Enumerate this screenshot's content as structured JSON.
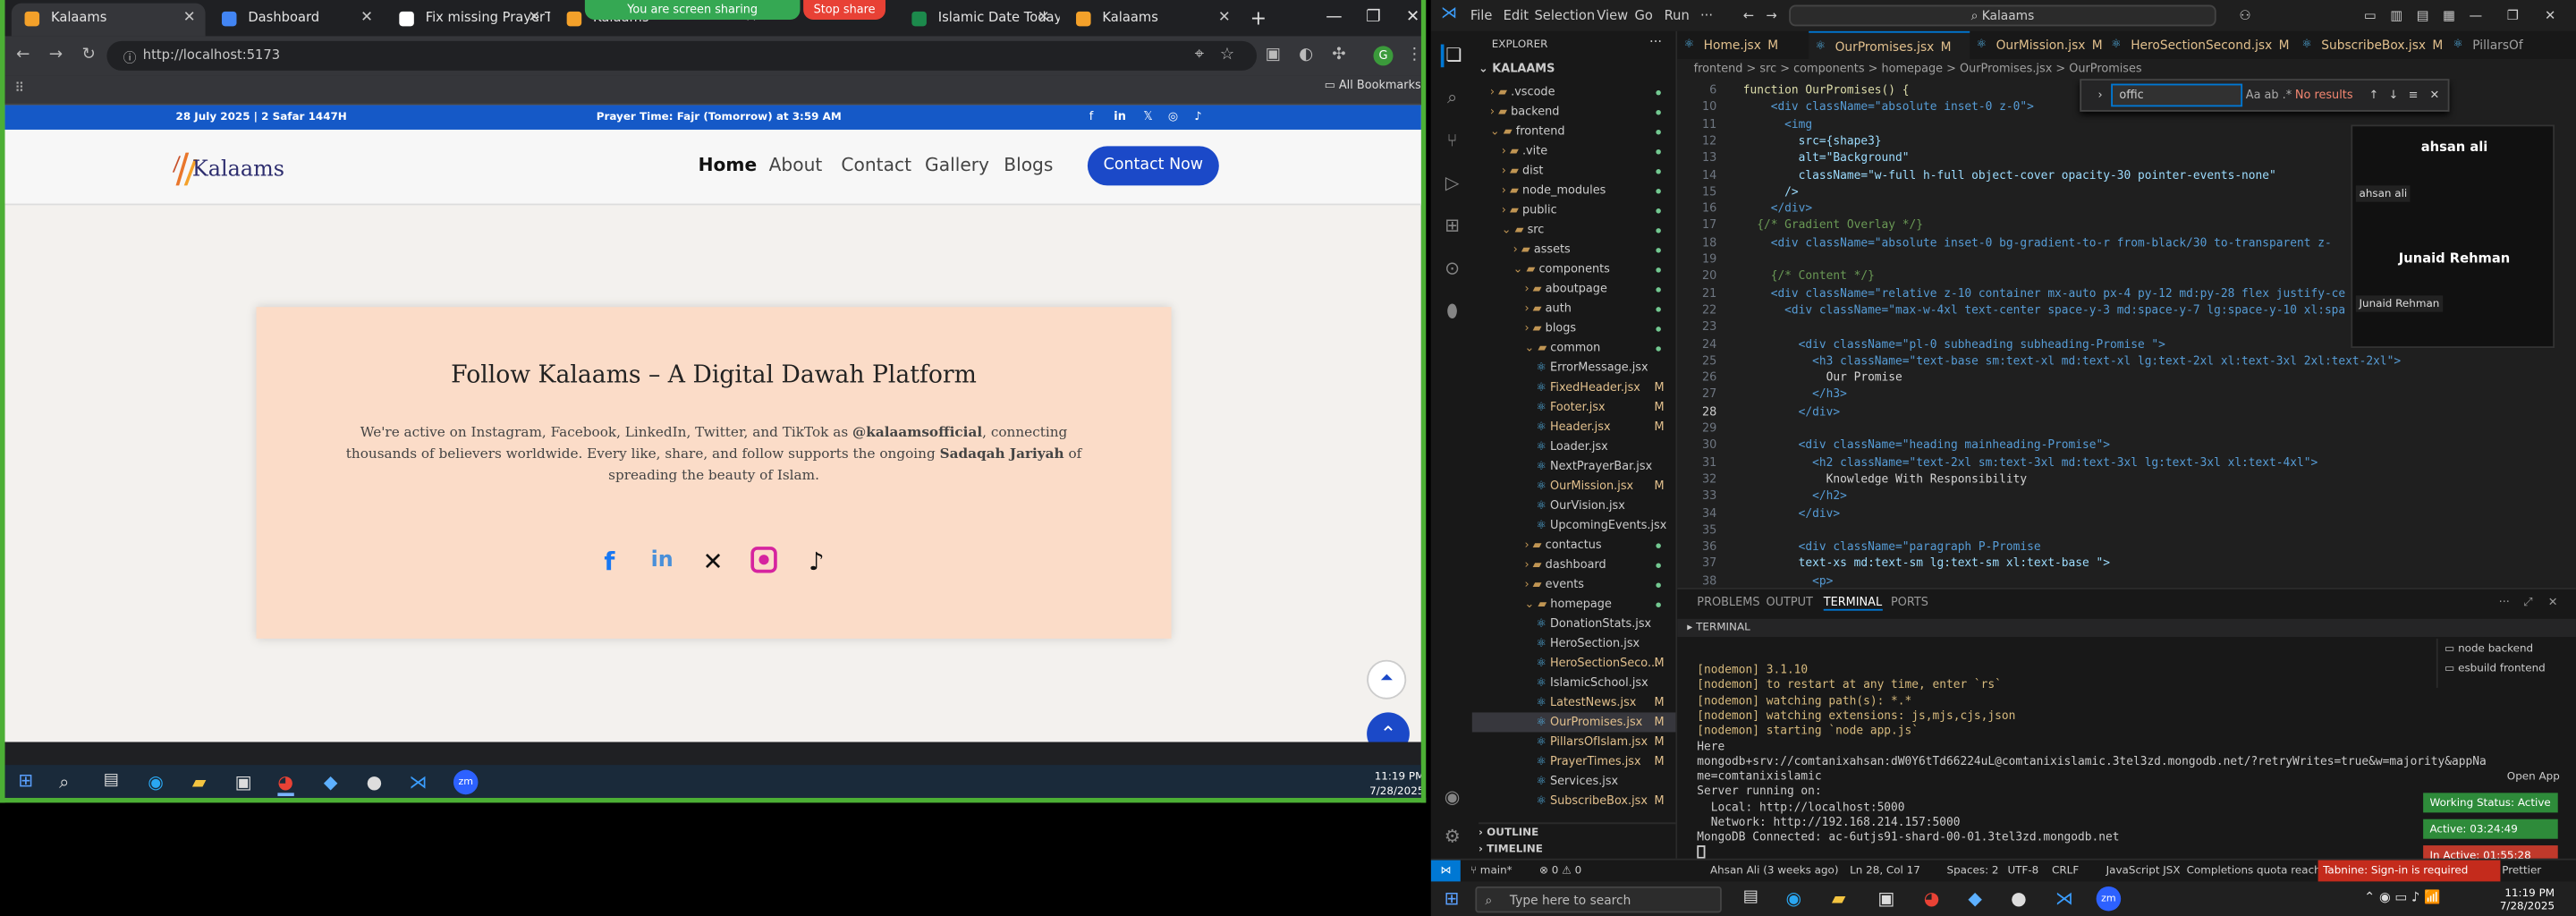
{
  "chrome": {
    "tabs": [
      {
        "label": "Kalaams",
        "color": "#f4a12a",
        "active": true
      },
      {
        "label": "Dashboard",
        "color": "#4285f4",
        "active": false
      },
      {
        "label": "Fix missing PrayerTime",
        "color": "#ffffff",
        "active": false
      },
      {
        "label": "Kalaams",
        "color": "#f4a12a",
        "active": false
      },
      {
        "label": "Islamic Date Today - H",
        "color": "#1c8a4c",
        "active": false
      },
      {
        "label": "Kalaams",
        "color": "#f4a12a",
        "active": false
      }
    ],
    "share_banner": "You are screen sharing",
    "stop_share": "Stop share",
    "address": "http://localhost:5173",
    "bookmarks_label": "All Bookmarks"
  },
  "site": {
    "top_date": "28 July 2025 | 2 Safar 1447H",
    "prayer_prefix": "Prayer Time: ",
    "prayer_name": "Fajr (Tomorrow)",
    "prayer_suffix": " at 3:59 AM",
    "logo_text": "Kalaams",
    "nav": [
      "Home",
      "About",
      "Contact",
      "Gallery",
      "Blogs"
    ],
    "contact_btn": "Contact Now",
    "card": {
      "title": "Follow Kalaams – A Digital Dawah Platform",
      "text_1": "We're active on Instagram, Facebook, LinkedIn, Twitter, and TikTok as ",
      "handle": "@kalaamsofficial",
      "text_2": ", connecting thousands of believers worldwide. Every like, share, and follow supports the ongoing ",
      "sadaqah": "Sadaqah Jariyah",
      "text_3": " of spreading the beauty of Islam."
    }
  },
  "taskbar_left": {
    "time": "11:19 PM",
    "date": "7/28/2025"
  },
  "vscode": {
    "menu": [
      "File",
      "Edit",
      "Selection",
      "View",
      "Go",
      "Run"
    ],
    "search": "Kalaams",
    "explorer_title": "EXPLORER",
    "workspace": "KALAAMS",
    "tree": [
      {
        "label": ".vscode",
        "indent": 1,
        "kind": "folder-closed"
      },
      {
        "label": "backend",
        "indent": 1,
        "kind": "folder-closed"
      },
      {
        "label": "frontend",
        "indent": 1,
        "kind": "folder-open"
      },
      {
        "label": ".vite",
        "indent": 2,
        "kind": "folder-closed"
      },
      {
        "label": "dist",
        "indent": 2,
        "kind": "folder-closed"
      },
      {
        "label": "node_modules",
        "indent": 2,
        "kind": "folder-closed"
      },
      {
        "label": "public",
        "indent": 2,
        "kind": "folder-closed"
      },
      {
        "label": "src",
        "indent": 2,
        "kind": "folder-open"
      },
      {
        "label": "assets",
        "indent": 3,
        "kind": "folder-closed"
      },
      {
        "label": "components",
        "indent": 3,
        "kind": "folder-open"
      },
      {
        "label": "aboutpage",
        "indent": 4,
        "kind": "folder-closed"
      },
      {
        "label": "auth",
        "indent": 4,
        "kind": "folder-closed"
      },
      {
        "label": "blogs",
        "indent": 4,
        "kind": "folder-closed"
      },
      {
        "label": "common",
        "indent": 4,
        "kind": "folder-open"
      },
      {
        "label": "ErrorMessage.jsx",
        "indent": 5,
        "kind": "file"
      },
      {
        "label": "FixedHeader.jsx",
        "indent": 5,
        "kind": "file",
        "mark": "M"
      },
      {
        "label": "Footer.jsx",
        "indent": 5,
        "kind": "file",
        "mark": "M"
      },
      {
        "label": "Header.jsx",
        "indent": 5,
        "kind": "file",
        "mark": "M"
      },
      {
        "label": "Loader.jsx",
        "indent": 5,
        "kind": "file"
      },
      {
        "label": "NextPrayerBar.jsx",
        "indent": 5,
        "kind": "file"
      },
      {
        "label": "OurMission.jsx",
        "indent": 5,
        "kind": "file",
        "mark": "M"
      },
      {
        "label": "OurVision.jsx",
        "indent": 5,
        "kind": "file"
      },
      {
        "label": "UpcomingEvents.jsx",
        "indent": 5,
        "kind": "file"
      },
      {
        "label": "contactus",
        "indent": 4,
        "kind": "folder-closed"
      },
      {
        "label": "dashboard",
        "indent": 4,
        "kind": "folder-closed"
      },
      {
        "label": "events",
        "indent": 4,
        "kind": "folder-closed"
      },
      {
        "label": "homepage",
        "indent": 4,
        "kind": "folder-open"
      },
      {
        "label": "DonationStats.jsx",
        "indent": 5,
        "kind": "file"
      },
      {
        "label": "HeroSection.jsx",
        "indent": 5,
        "kind": "file"
      },
      {
        "label": "HeroSectionSeco...",
        "indent": 5,
        "kind": "file",
        "mark": "M"
      },
      {
        "label": "IslamicSchool.jsx",
        "indent": 5,
        "kind": "file"
      },
      {
        "label": "LatestNews.jsx",
        "indent": 5,
        "kind": "file",
        "mark": "M"
      },
      {
        "label": "OurPromises.jsx",
        "indent": 5,
        "kind": "file",
        "mark": "M",
        "selected": true
      },
      {
        "label": "PillarsOfIslam.jsx",
        "indent": 5,
        "kind": "file",
        "mark": "M"
      },
      {
        "label": "PrayerTimes.jsx",
        "indent": 5,
        "kind": "file",
        "mark": "M"
      },
      {
        "label": "Services.jsx",
        "indent": 5,
        "kind": "file"
      },
      {
        "label": "SubscribeBox.jsx",
        "indent": 5,
        "kind": "file",
        "mark": "M"
      }
    ],
    "outline": "OUTLINE",
    "timeline": "TIMELINE",
    "editor_tabs": [
      {
        "label": "Home.jsx",
        "mark": "M"
      },
      {
        "label": "OurPromises.jsx",
        "mark": "M",
        "active": true
      },
      {
        "label": "OurMission.jsx",
        "mark": "M"
      },
      {
        "label": "HeroSectionSecond.jsx",
        "mark": "M"
      },
      {
        "label": "SubscribeBox.jsx",
        "mark": "M"
      },
      {
        "label": "PillarsOf",
        "mark": ""
      }
    ],
    "breadcrumb": "frontend > src > components > homepage > OurPromises.jsx > OurPromises",
    "find_value": "offic",
    "find_result": "No results",
    "code": [
      {
        "n": "6",
        "t": "function OurPromises() {"
      },
      {
        "n": "10",
        "t": "    <div className=\"absolute inset-0 z-0\">"
      },
      {
        "n": "11",
        "t": "      <img"
      },
      {
        "n": "12",
        "t": "        src={shape3}"
      },
      {
        "n": "13",
        "t": "        alt=\"Background\""
      },
      {
        "n": "14",
        "t": "        className=\"w-full h-full object-cover opacity-30 pointer-events-none\""
      },
      {
        "n": "15",
        "t": "      />"
      },
      {
        "n": "16",
        "t": "    </div>"
      },
      {
        "n": "17",
        "t": "  {/* Gradient Overlay */}"
      },
      {
        "n": "18",
        "t": "    <div className=\"absolute inset-0 bg-gradient-to-r from-black/30 to-transparent z-"
      },
      {
        "n": "19",
        "t": ""
      },
      {
        "n": "20",
        "t": "    {/* Content */}"
      },
      {
        "n": "21",
        "t": "    <div className=\"relative z-10 container mx-auto px-4 py-12 md:py-28 flex justify-ce"
      },
      {
        "n": "22",
        "t": "      <div className=\"max-w-4xl text-center space-y-3 md:space-y-7 lg:space-y-10 xl:spa"
      },
      {
        "n": "23",
        "t": ""
      },
      {
        "n": "24",
        "t": "        <div className=\"pl-0 subheading subheading-Promise \">"
      },
      {
        "n": "25",
        "t": "          <h3 className=\"text-base sm:text-xl md:text-xl lg:text-2xl xl:text-3xl 2xl:text-2xl\">"
      },
      {
        "n": "26",
        "t": "            Our Promise"
      },
      {
        "n": "27",
        "t": "          </h3>"
      },
      {
        "n": "28",
        "t": "        </div>"
      },
      {
        "n": "29",
        "t": ""
      },
      {
        "n": "30",
        "t": "        <div className=\"heading mainheading-Promise\">"
      },
      {
        "n": "31",
        "t": "          <h2 className=\"text-2xl sm:text-3xl md:text-3xl lg:text-3xl xl:text-4xl\">"
      },
      {
        "n": "32",
        "t": "            Knowledge With Responsibility"
      },
      {
        "n": "33",
        "t": "          </h2>"
      },
      {
        "n": "34",
        "t": "        </div>"
      },
      {
        "n": "35",
        "t": ""
      },
      {
        "n": "36",
        "t": "        <div className=\"paragraph P-Promise"
      },
      {
        "n": "37",
        "t": "        text-xs md:text-sm lg:text-sm xl:text-base \">"
      },
      {
        "n": "38",
        "t": "          <p>"
      }
    ],
    "participants": [
      {
        "name": "ahsan ali",
        "tag": "ahsan ali"
      },
      {
        "name": "Junaid Rehman",
        "tag": "Junaid Rehman"
      }
    ],
    "panel_tabs": [
      "PROBLEMS",
      "OUTPUT",
      "TERMINAL",
      "PORTS"
    ],
    "terminal_title": "TERMINAL",
    "terminal_lines": [
      "[nodemon] 3.1.10",
      "[nodemon] to restart at any time, enter `rs`",
      "[nodemon] watching path(s): *.*",
      "[nodemon] watching extensions: js,mjs,cjs,json",
      "[nodemon] starting `node app.js`",
      "Here",
      "mongodb+srv://comtanixahsan:dW0Y6tTd66224uL@comtanixislamic.3tel3zd.mongodb.net/?retryWrites=true&w=majority&appNa",
      "me=comtanixislamic",
      "Server running on:",
      "  Local: http://localhost:5000",
      "  Network: http://192.168.214.157:5000",
      "MongoDB Connected: ac-6utjs91-shard-00-01.3tel3zd.mongodb.net"
    ],
    "terminals": [
      "node backend",
      "esbuild frontend"
    ],
    "open_app": "Open App",
    "working_status": "Working Status: Active",
    "active_time": "Active: 03:24:49",
    "inactive_time": "In Active: 01:55:28",
    "status_branch": "main*",
    "status_errors": "⊗ 0 ⚠ 0",
    "status_blame": "Ahsan Ali (3 weeks ago)",
    "status_pos": "Ln 28, Col 17",
    "status_spaces": "Spaces: 2",
    "status_enc": "UTF-8",
    "status_eol": "CRLF",
    "status_lang": "JavaScript JSX",
    "status_quota": "Completions quota reached",
    "status_tabnine": "Tabnine: Sign-in is required",
    "status_prettier": "Prettier"
  },
  "taskbar_right": {
    "search": "Type here to search",
    "time": "11:19 PM",
    "date": "7/28/2025"
  }
}
